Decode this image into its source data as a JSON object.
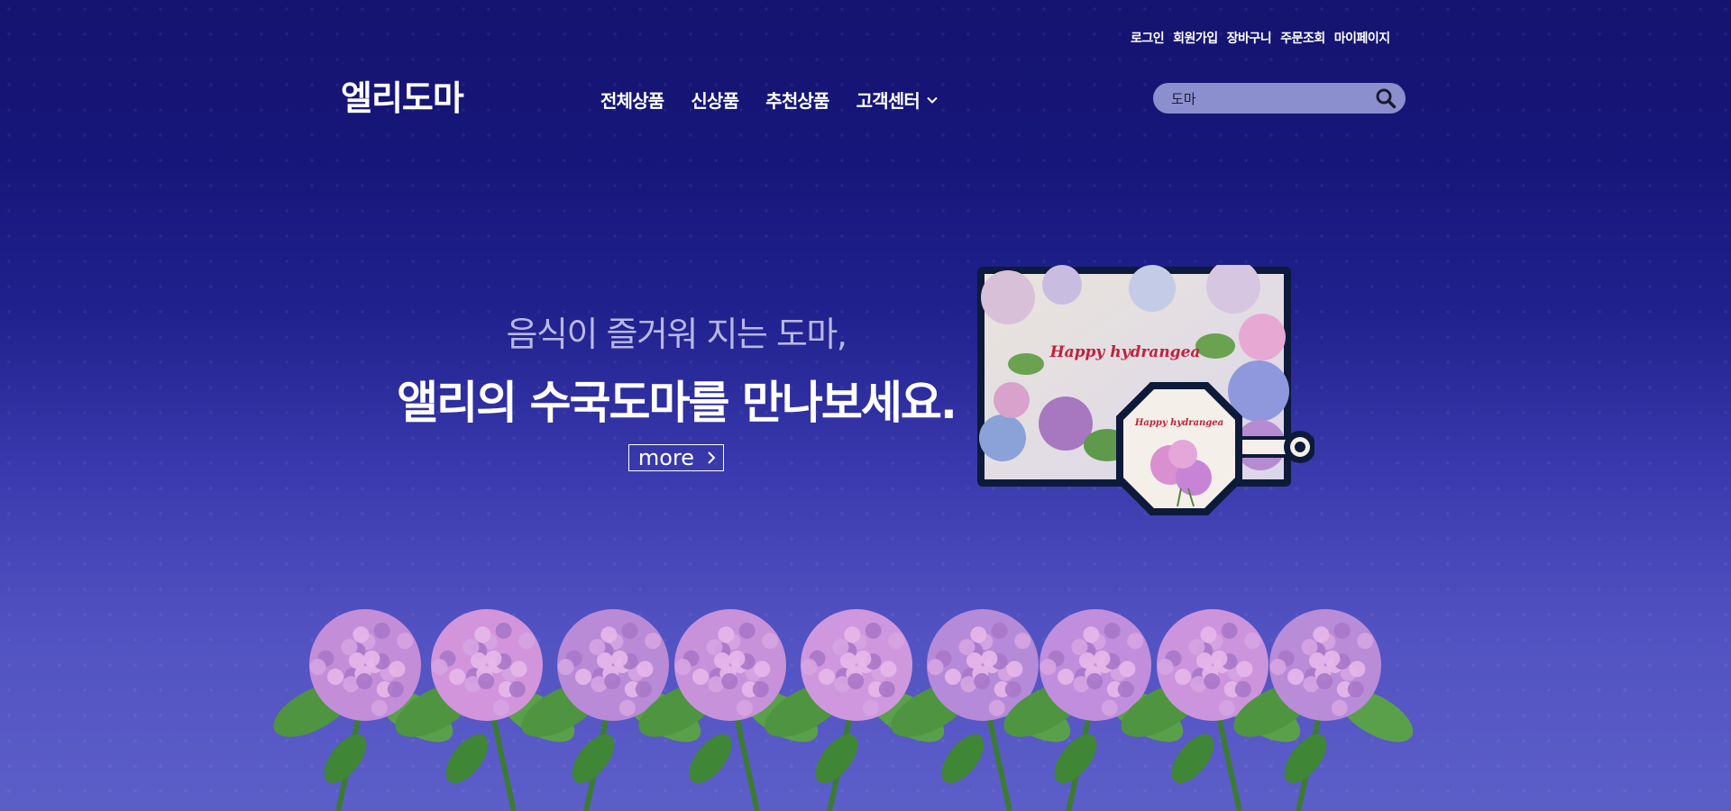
{
  "utility": {
    "login": "로그인",
    "signup": "회원가입",
    "cart": "장바구니",
    "orders": "주문조회",
    "mypage": "마이페이지"
  },
  "logo": "엘리도마",
  "nav": {
    "all": "전체상품",
    "new": "신상품",
    "recommended": "추천상품",
    "support": "고객센터"
  },
  "search": {
    "value": "도마"
  },
  "hero": {
    "subtitle": "음식이 즐거워 지는 도마,",
    "title": "앨리의 수국도마를 만나보세요.",
    "more": "more"
  },
  "product": {
    "board_text": "Happy hydrangea",
    "small_text": "Happy hydrangea"
  },
  "colors": {
    "background_top": "#151470",
    "background_bottom": "#5c5ec8",
    "search_bg": "#8c8fcd",
    "hydrangea": "#c690d8"
  }
}
